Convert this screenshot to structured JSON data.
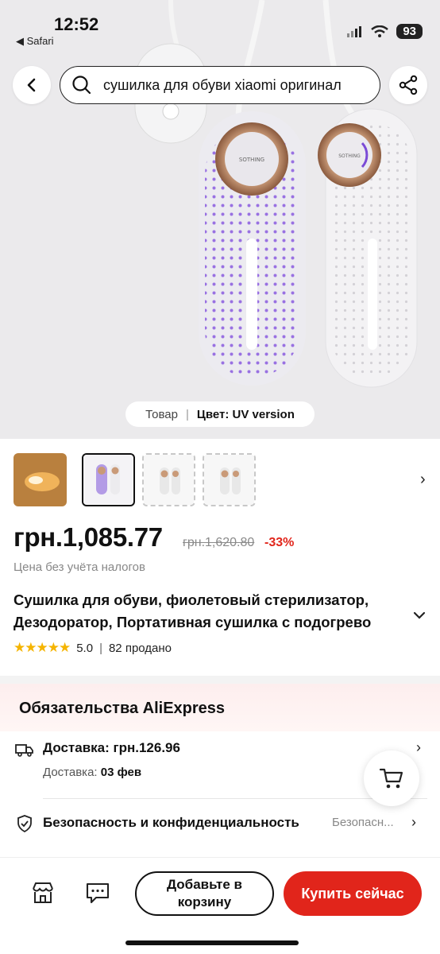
{
  "status_bar": {
    "time": "12:52",
    "back_app": "◀ Safari",
    "battery": "93"
  },
  "header": {
    "search_value": "сушилка для обуви xiaomi оригинал"
  },
  "product_image": {
    "brand_mark": "SOTHING",
    "variant_kind": "Товар",
    "variant_label": "Цвет:",
    "variant_value": "UV version"
  },
  "thumbnails": [
    {
      "name": "thumb-orange"
    },
    {
      "name": "thumb-uv-selected",
      "selected": true
    },
    {
      "name": "thumb-white-1"
    },
    {
      "name": "thumb-white-2"
    }
  ],
  "price": {
    "current": "грн.1,085.77",
    "old": "грн.1,620.80",
    "discount": "-33%",
    "tax_note": "Цена без учёта налогов"
  },
  "product": {
    "title_line1": "Сушилка для обуви, фиолетовый стерилизатор,",
    "title_line2": "Дезодоратор, Портативная сушилка с подогрево",
    "rating": "5.0",
    "sold": "82 продано"
  },
  "commitments": {
    "title": "Обязательства AliExpress",
    "shipping_main": "Доставка: грн.126.96",
    "shipping_sub_label": "Доставка:",
    "shipping_sub_value": "03 фев",
    "security_main": "Безопасность и конфиденциальность",
    "security_value": "Безопасн..."
  },
  "bottom_bar": {
    "add_to_cart": "Добавьте в корзину",
    "buy_now": "Купить сейчас"
  },
  "colors": {
    "accent_red": "#e1251b",
    "uv_purple": "#7b4bd6",
    "star_gold": "#f5b400"
  }
}
